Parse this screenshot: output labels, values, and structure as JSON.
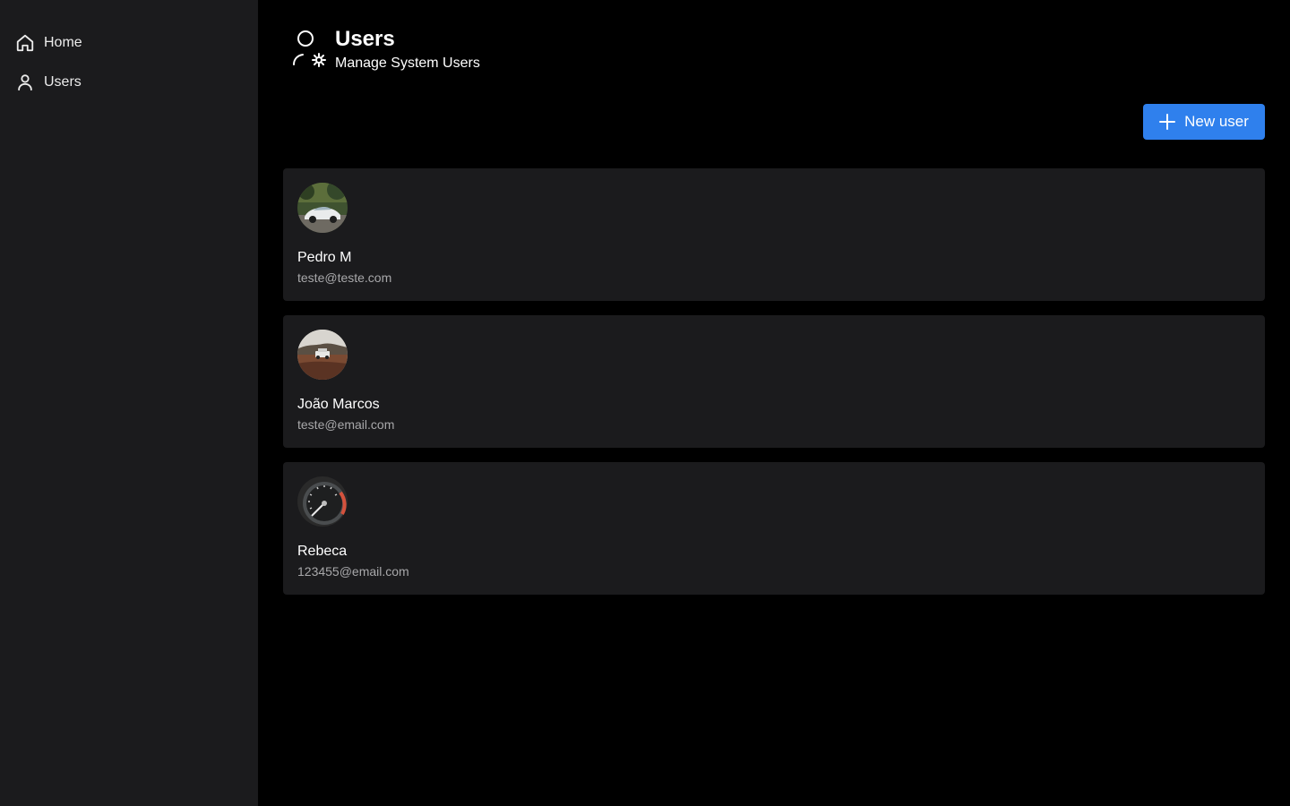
{
  "sidebar": {
    "items": [
      {
        "label": "Home",
        "icon": "home-icon"
      },
      {
        "label": "Users",
        "icon": "user-icon"
      }
    ]
  },
  "header": {
    "icon": "user-cog-icon",
    "title": "Users",
    "subtitle": "Manage System Users"
  },
  "toolbar": {
    "new_user_label": "New user",
    "new_user_icon": "plus-icon"
  },
  "users": [
    {
      "name": "Pedro M",
      "email": "teste@teste.com",
      "avatar": "white-sports-car-photo"
    },
    {
      "name": "João Marcos",
      "email": "teste@email.com",
      "avatar": "suv-on-road-photo"
    },
    {
      "name": "Rebeca",
      "email": "123455@email.com",
      "avatar": "speedometer-photo"
    }
  ],
  "colors": {
    "accent": "#2f80ed",
    "sidebar_bg": "#1b1b1d",
    "card_bg": "#1b1b1d",
    "page_bg": "#000000",
    "muted_text": "#a8a8aa"
  }
}
